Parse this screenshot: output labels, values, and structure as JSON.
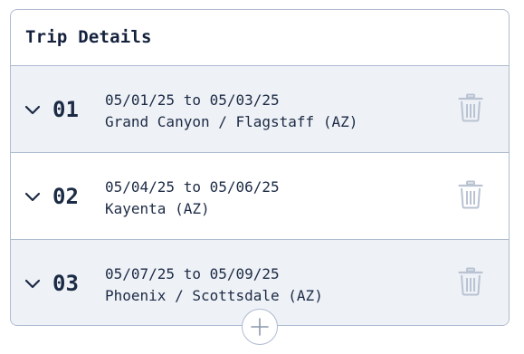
{
  "card": {
    "title": "Trip Details"
  },
  "legs": [
    {
      "number": "01",
      "dates": "05/01/25 to 05/03/25",
      "location": "Grand Canyon / Flagstaff (AZ)",
      "icon": "chevron-down-icon",
      "action_icon": "trash-icon"
    },
    {
      "number": "02",
      "dates": "05/04/25 to 05/06/25",
      "location": "Kayenta (AZ)",
      "icon": "chevron-down-icon",
      "action_icon": "trash-icon"
    },
    {
      "number": "03",
      "dates": "05/07/25 to 05/09/25",
      "location": "Phoenix / Scottsdale (AZ)",
      "icon": "chevron-down-icon",
      "action_icon": "trash-icon"
    }
  ],
  "add_button": {
    "icon": "plus-icon"
  },
  "colors": {
    "text": "#1c2b45",
    "border": "#aebbd0",
    "shaded_row": "#eef1f6",
    "icon_muted": "#b9c3d2"
  }
}
